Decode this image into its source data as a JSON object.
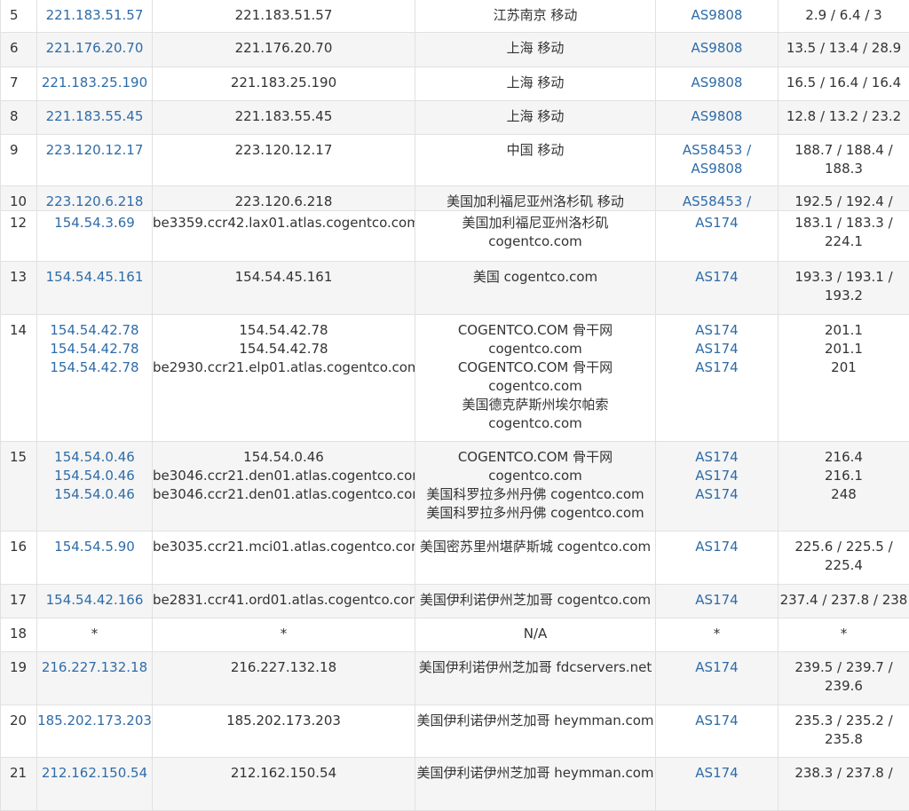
{
  "colors": {
    "link": "#2e6ca8",
    "text": "#333333",
    "border": "#e1e1e1",
    "zebra": "#f5f5f5"
  },
  "section1": [
    {
      "hop": "5",
      "ip": [
        "221.183.51.57"
      ],
      "host": [
        "221.183.51.57"
      ],
      "loc": [
        "江苏南京 移动"
      ],
      "as": [
        "AS9808"
      ],
      "rtt": [
        "2.9 / 6.4 / 3"
      ]
    },
    {
      "hop": "6",
      "ip": [
        "221.176.20.70"
      ],
      "host": [
        "221.176.20.70"
      ],
      "loc": [
        "上海 移动"
      ],
      "as": [
        "AS9808"
      ],
      "rtt": [
        "13.5 / 13.4 / 28.9"
      ]
    },
    {
      "hop": "7",
      "ip": [
        "221.183.25.190"
      ],
      "host": [
        "221.183.25.190"
      ],
      "loc": [
        "上海 移动"
      ],
      "as": [
        "AS9808"
      ],
      "rtt": [
        "16.5 / 16.4 / 16.4"
      ]
    },
    {
      "hop": "8",
      "ip": [
        "221.183.55.45"
      ],
      "host": [
        "221.183.55.45"
      ],
      "loc": [
        "上海 移动"
      ],
      "as": [
        "AS9808"
      ],
      "rtt": [
        "12.8 / 13.2 / 23.2"
      ]
    },
    {
      "hop": "9",
      "ip": [
        "223.120.12.17"
      ],
      "host": [
        "223.120.12.17"
      ],
      "loc": [
        "中国 移动"
      ],
      "as": [
        "AS58453 /",
        "AS9808"
      ],
      "rtt": [
        "188.7 / 188.4 /",
        "188.3"
      ]
    },
    {
      "hop": "10",
      "ip": [
        "223.120.6.218"
      ],
      "host": [
        "223.120.6.218"
      ],
      "loc": [
        "美国加利福尼亚州洛杉矶 移动"
      ],
      "as": [
        "AS58453 /"
      ],
      "rtt": [
        "192.5 / 192.4 /"
      ]
    }
  ],
  "section2": [
    {
      "hop": "12",
      "ip": [
        "154.54.3.69"
      ],
      "host": [
        "be3359.ccr42.lax01.atlas.cogentco.com"
      ],
      "loc": [
        "美国加利福尼亚州洛杉矶",
        "cogentco.com"
      ],
      "as": [
        "AS174"
      ],
      "rtt": [
        "183.1 / 183.3 /",
        "224.1"
      ]
    },
    {
      "hop": "13",
      "ip": [
        "154.54.45.161"
      ],
      "host": [
        "154.54.45.161"
      ],
      "loc": [
        "美国 cogentco.com"
      ],
      "as": [
        "AS174"
      ],
      "rtt": [
        "193.3 / 193.1 /",
        "193.2"
      ]
    },
    {
      "hop": "14",
      "ip": [
        "154.54.42.78",
        "154.54.42.78",
        "154.54.42.78"
      ],
      "host": [
        "154.54.42.78",
        "154.54.42.78",
        "be2930.ccr21.elp01.atlas.cogentco.com"
      ],
      "loc": [
        "COGENTCO.COM 骨干网",
        "cogentco.com",
        "COGENTCO.COM 骨干网",
        "cogentco.com",
        "美国德克萨斯州埃尔帕索",
        "cogentco.com"
      ],
      "as": [
        "AS174",
        "AS174",
        "AS174"
      ],
      "rtt": [
        "201.1",
        "201.1",
        "201"
      ]
    },
    {
      "hop": "15",
      "ip": [
        "154.54.0.46",
        "154.54.0.46",
        "154.54.0.46"
      ],
      "host": [
        "154.54.0.46",
        "be3046.ccr21.den01.atlas.cogentco.com",
        "be3046.ccr21.den01.atlas.cogentco.com"
      ],
      "loc": [
        "COGENTCO.COM 骨干网",
        "cogentco.com",
        "美国科罗拉多州丹佛 cogentco.com",
        "美国科罗拉多州丹佛 cogentco.com"
      ],
      "as": [
        "AS174",
        "AS174",
        "AS174"
      ],
      "rtt": [
        "216.4",
        "216.1",
        "248"
      ]
    },
    {
      "hop": "16",
      "ip": [
        "154.54.5.90"
      ],
      "host": [
        "be3035.ccr21.mci01.atlas.cogentco.com"
      ],
      "loc": [
        "美国密苏里州堪萨斯城 cogentco.com"
      ],
      "as": [
        "AS174"
      ],
      "rtt": [
        "225.6 / 225.5 /",
        "225.4"
      ]
    },
    {
      "hop": "17",
      "ip": [
        "154.54.42.166"
      ],
      "host": [
        "be2831.ccr41.ord01.atlas.cogentco.com"
      ],
      "loc": [
        "美国伊利诺伊州芝加哥 cogentco.com"
      ],
      "as": [
        "AS174"
      ],
      "rtt": [
        "237.4 / 237.8 / 238"
      ]
    },
    {
      "hop": "18",
      "ip": [
        "*"
      ],
      "host": [
        "*"
      ],
      "loc": [
        "N/A"
      ],
      "as": [
        "*"
      ],
      "rtt": [
        "*"
      ]
    },
    {
      "hop": "19",
      "ip": [
        "216.227.132.18"
      ],
      "host": [
        "216.227.132.18"
      ],
      "loc": [
        "美国伊利诺伊州芝加哥 fdcservers.net"
      ],
      "as": [
        "AS174"
      ],
      "rtt": [
        "239.5 / 239.7 /",
        "239.6"
      ]
    },
    {
      "hop": "20",
      "ip": [
        "185.202.173.203"
      ],
      "host": [
        "185.202.173.203"
      ],
      "loc": [
        "美国伊利诺伊州芝加哥 heymman.com"
      ],
      "as": [
        "AS174"
      ],
      "rtt": [
        "235.3 / 235.2 /",
        "235.8"
      ]
    },
    {
      "hop": "21",
      "ip": [
        "212.162.150.54"
      ],
      "host": [
        "212.162.150.54"
      ],
      "loc": [
        "美国伊利诺伊州芝加哥 heymman.com"
      ],
      "as": [
        "AS174"
      ],
      "rtt": [
        "238.3 / 237.8 /"
      ]
    }
  ]
}
